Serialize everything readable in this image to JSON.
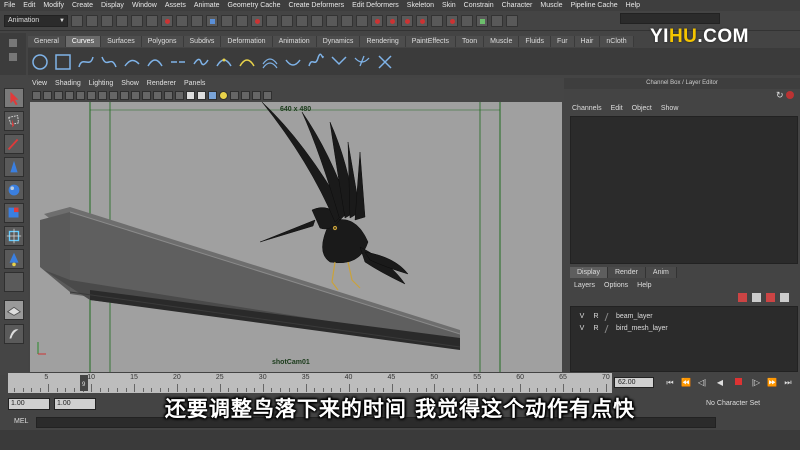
{
  "menubar": [
    "File",
    "Edit",
    "Modify",
    "Create",
    "Display",
    "Window",
    "Assets",
    "Animate",
    "Geometry Cache",
    "Create Deformers",
    "Edit Deformers",
    "Skeleton",
    "Skin",
    "Constrain",
    "Character",
    "Muscle",
    "Pipeline Cache",
    "Help"
  ],
  "statusline": {
    "menuset": "Animation"
  },
  "logo": {
    "text_a": "YI",
    "text_b": "HU",
    "text_c": ".COM"
  },
  "shelf": {
    "tabs": [
      "General",
      "Curves",
      "Surfaces",
      "Polygons",
      "Subdivs",
      "Deformation",
      "Animation",
      "Dynamics",
      "Rendering",
      "PaintEffects",
      "Toon",
      "Muscle",
      "Fluids",
      "Fur",
      "Hair",
      "nCloth"
    ],
    "active_tab": "Curves"
  },
  "viewport": {
    "menu": [
      "View",
      "Shading",
      "Lighting",
      "Show",
      "Renderer",
      "Panels"
    ],
    "resolution_gate": "640 x 480",
    "camera_name": "shotCam01"
  },
  "channelbox": {
    "title": "Channel Box / Layer Editor",
    "menu": [
      "Channels",
      "Edit",
      "Object",
      "Show"
    ]
  },
  "layer_editor": {
    "tabs": [
      "Display",
      "Render",
      "Anim"
    ],
    "active_tab": "Display",
    "menu": [
      "Layers",
      "Options",
      "Help"
    ],
    "layers": [
      {
        "v": "V",
        "p": "R",
        "name": "beam_layer"
      },
      {
        "v": "V",
        "p": "R",
        "name": "bird_mesh_layer"
      }
    ]
  },
  "timeslider": {
    "ticks": [
      "5",
      "10",
      "15",
      "20",
      "25",
      "30",
      "35",
      "40",
      "45",
      "50",
      "55",
      "60",
      "65",
      "70"
    ],
    "current_frame_marker": "9",
    "current_frame_value": "62.00"
  },
  "rangeslider": {
    "start": "1.00",
    "start2": "1.00",
    "character_set": "No Character Set"
  },
  "mel": {
    "label": "MEL"
  },
  "subtitle": "还要调整鸟落下来的时间 我觉得这个动作有点快",
  "colors": {
    "accent_yellow": "#f4c400",
    "viewport_bg": "#a0a0a0",
    "timeline_bg": "#bdbdbd"
  }
}
